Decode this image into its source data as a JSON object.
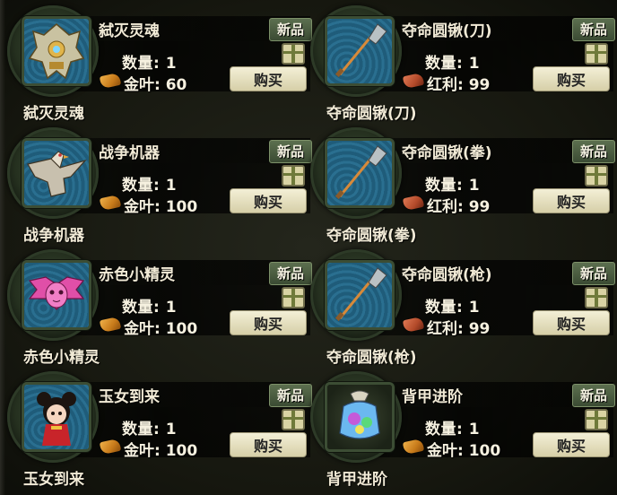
{
  "labels": {
    "new": "新品",
    "buy": "购买",
    "quantity_prefix": "数量: "
  },
  "items": [
    {
      "name": "弑灭灵魂",
      "quantity": "1",
      "currency": "金叶",
      "price": "60",
      "caption": "弑灭灵魂",
      "icon": "mecha-armor-icon"
    },
    {
      "name": "夺命圆锹(刀)",
      "quantity": "1",
      "currency": "红利",
      "price": "99",
      "caption": "夺命圆锹(刀)",
      "icon": "shovel-icon"
    },
    {
      "name": "战争机器",
      "quantity": "1",
      "currency": "金叶",
      "price": "100",
      "caption": "战争机器",
      "icon": "eagle-mount-icon"
    },
    {
      "name": "夺命圆锹(拳)",
      "quantity": "1",
      "currency": "红利",
      "price": "99",
      "caption": "夺命圆锹(拳)",
      "icon": "shovel-icon"
    },
    {
      "name": "赤色小精灵",
      "quantity": "1",
      "currency": "金叶",
      "price": "100",
      "caption": "赤色小精灵",
      "icon": "pink-sprite-icon"
    },
    {
      "name": "夺命圆锹(枪)",
      "quantity": "1",
      "currency": "红利",
      "price": "99",
      "caption": "夺命圆锹(枪)",
      "icon": "shovel-icon"
    },
    {
      "name": "玉女到来",
      "quantity": "1",
      "currency": "金叶",
      "price": "100",
      "caption": "玉女到来",
      "icon": "girl-doll-icon"
    },
    {
      "name": "背甲进阶",
      "quantity": "1",
      "currency": "金叶",
      "price": "100",
      "caption": "背甲进阶",
      "icon": "gift-bag-icon"
    }
  ]
}
